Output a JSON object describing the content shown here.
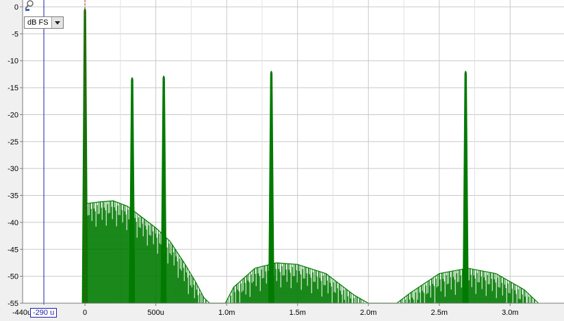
{
  "chart_data": {
    "type": "line",
    "title": "",
    "xlabel": "",
    "ylabel": "",
    "xlim": [
      -0.00044,
      0.00338
    ],
    "ylim": [
      -55,
      0
    ],
    "grid": true,
    "y_ticks": [
      0,
      -5,
      -10,
      -15,
      -20,
      -25,
      -30,
      -35,
      -40,
      -45,
      -50,
      -55
    ],
    "y_tick_labels": [
      "0",
      "-5",
      "-10",
      "-15",
      "-20",
      "-25",
      "-30",
      "-35",
      "-40",
      "-45",
      "-50",
      "-55"
    ],
    "x_ticks": [
      0,
      0.0005,
      0.001,
      0.0015,
      0.002,
      0.0025,
      0.003
    ],
    "x_tick_labels": [
      "0",
      "500u",
      "1.0m",
      "1.5m",
      "2.0m",
      "2.5m",
      "3.0m"
    ],
    "x_start_label": "-440u",
    "series_color": "#007a00",
    "peaks": [
      {
        "x": 0.0,
        "y": 0
      },
      {
        "x": 0.000333,
        "y": -12.8
      },
      {
        "x": 0.000556,
        "y": -12.5
      },
      {
        "x": 0.001315,
        "y": -11.6
      },
      {
        "x": 0.002686,
        "y": -11.6
      }
    ],
    "noise_envelope": [
      {
        "x": 1e-05,
        "y": -36.5
      },
      {
        "x": 0.0001,
        "y": -36.2
      },
      {
        "x": 0.0002,
        "y": -36.0
      },
      {
        "x": 0.0003,
        "y": -37.0
      },
      {
        "x": 0.0004,
        "y": -39.0
      },
      {
        "x": 0.0005,
        "y": -41.0
      },
      {
        "x": 0.0006,
        "y": -43.5
      },
      {
        "x": 0.0007,
        "y": -47.5
      },
      {
        "x": 0.00078,
        "y": -51.0
      },
      {
        "x": 0.00084,
        "y": -54.0
      },
      {
        "x": 0.00088,
        "y": -55.0
      },
      {
        "x": 0.00099,
        "y": -55.0
      },
      {
        "x": 0.00105,
        "y": -52.0
      },
      {
        "x": 0.0012,
        "y": -48.5
      },
      {
        "x": 0.00135,
        "y": -47.5
      },
      {
        "x": 0.0015,
        "y": -47.8
      },
      {
        "x": 0.0017,
        "y": -49.5
      },
      {
        "x": 0.0019,
        "y": -53.5
      },
      {
        "x": 0.002,
        "y": -55.0
      },
      {
        "x": 0.0022,
        "y": -55.0
      },
      {
        "x": 0.0023,
        "y": -53.0
      },
      {
        "x": 0.0025,
        "y": -49.5
      },
      {
        "x": 0.0027,
        "y": -48.5
      },
      {
        "x": 0.0029,
        "y": -49.5
      },
      {
        "x": 0.0031,
        "y": -52.5
      },
      {
        "x": 0.0032,
        "y": -55.0
      }
    ],
    "cursor_x": -0.00029,
    "cursor_color": "#1c1cb0"
  },
  "controls": {
    "unit_value": "dB FS",
    "cursor_label": "-290 u"
  }
}
